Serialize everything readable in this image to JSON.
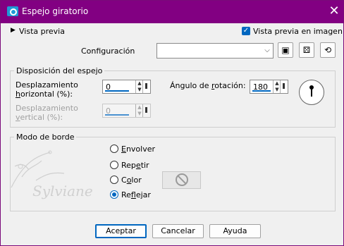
{
  "titlebar": {
    "title": "Espejo giratorio",
    "close_glyph": "✕"
  },
  "preview": {
    "toggle_label": "Vista previa",
    "toggle_glyph": "▶",
    "checkbox_label": "Vista previa en imagen",
    "checked": true
  },
  "config": {
    "label": "Configuración",
    "value": "",
    "icons": [
      "save-icon",
      "dice-icon",
      "reset-icon"
    ]
  },
  "mirror_group": {
    "title": "Disposición del espejo",
    "h_offset": {
      "label_line1": "Desplazamiento",
      "label_line2_prefix": "",
      "label_line2_u": "h",
      "label_line2_rest": "orizontal (%):",
      "value": "0",
      "enabled": true
    },
    "v_offset": {
      "label_line1": "Desplazamiento",
      "label_line2_u": "v",
      "label_line2_rest": "ertical (%):",
      "value": "0",
      "enabled": false
    },
    "rotation": {
      "label_prefix": "Ángulo de ",
      "label_u": "r",
      "label_rest": "otación:",
      "value": "180"
    }
  },
  "border_group": {
    "title": "Modo de borde",
    "options": [
      {
        "u": "E",
        "rest": "nvolver",
        "selected": false
      },
      {
        "pre": "Rep",
        "u": "e",
        "rest": "tir",
        "selected": false
      },
      {
        "pre": "C",
        "u": "o",
        "rest": "lor",
        "selected": false
      },
      {
        "pre": "Re",
        "u": "f",
        "rest": "lejar",
        "selected": true
      }
    ],
    "watermark": "Sylviane"
  },
  "footer": {
    "ok": "Aceptar",
    "cancel": "Cancelar",
    "help": "Ayuda"
  },
  "colors": {
    "titlebar": "#820082",
    "accent": "#0067c0",
    "window": "#f0f0f0"
  }
}
